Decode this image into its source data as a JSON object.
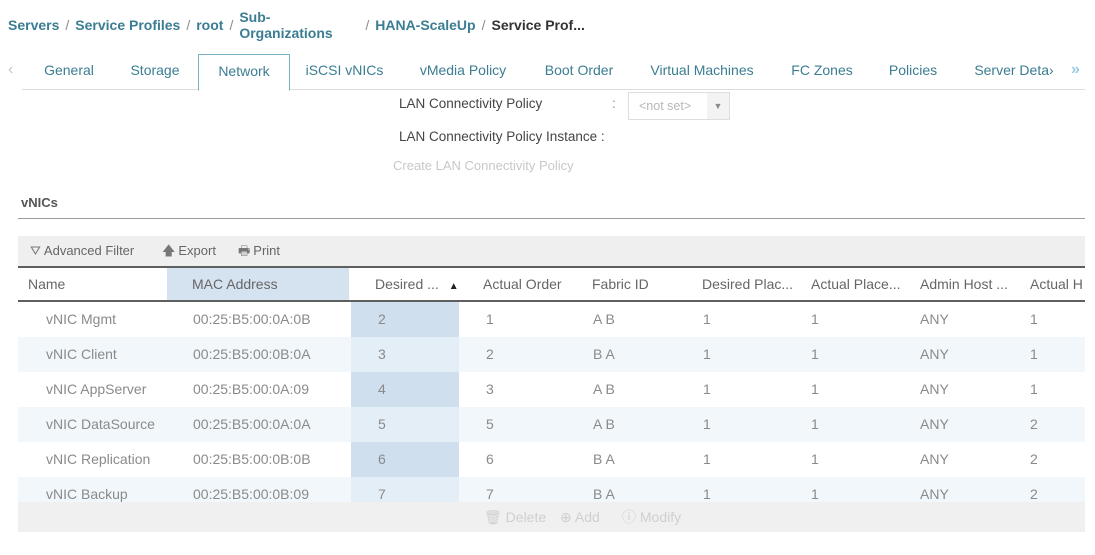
{
  "breadcrumb": {
    "items": [
      "Servers",
      "Service Profiles",
      "root"
    ],
    "sub_org_line1": "Sub-",
    "sub_org_line2": "Organizations",
    "org": "HANA-ScaleUp",
    "current": "Service Prof...",
    "separator": "/"
  },
  "tabs": {
    "prev_icon": "‹",
    "next_icon": "»",
    "items": [
      {
        "label": "General"
      },
      {
        "label": "Storage"
      },
      {
        "label": "Network",
        "active": true
      },
      {
        "label": "iSCSI vNICs"
      },
      {
        "label": "vMedia Policy"
      },
      {
        "label": "Boot Order"
      },
      {
        "label": "Virtual Machines"
      },
      {
        "label": "FC Zones"
      },
      {
        "label": "Policies"
      },
      {
        "label": "Server Deta›"
      }
    ]
  },
  "lan": {
    "policy_label": "LAN Connectivity Policy",
    "colon": ":",
    "policy_value": "<not set>",
    "dropdown_icon": "▼",
    "instance_label": "LAN Connectivity Policy Instance :",
    "create_link": "Create LAN Connectivity Policy"
  },
  "vnics": {
    "title": "vNICs",
    "toolbar": {
      "filter_icon": "⛛",
      "filter_label": "Advanced Filter",
      "export_icon": "🡅",
      "export_label": "Export",
      "print_icon": "🖶",
      "print_label": "Print"
    },
    "columns": [
      "Name",
      "MAC Address",
      "Desired ...",
      "Actual Order",
      "Fabric ID",
      "Desired Plac...",
      "Actual Place...",
      "Admin Host ...",
      "Actual H"
    ],
    "sort_icon": "▲",
    "rows": [
      [
        "vNIC Mgmt",
        "00:25:B5:00:0A:0B",
        "2",
        "1",
        "A B",
        "1",
        "1",
        "ANY",
        "1"
      ],
      [
        "vNIC Client",
        "00:25:B5:00:0B:0A",
        "3",
        "2",
        "B A",
        "1",
        "1",
        "ANY",
        "1"
      ],
      [
        "vNIC AppServer",
        "00:25:B5:00:0A:09",
        "4",
        "3",
        "A B",
        "1",
        "1",
        "ANY",
        "1"
      ],
      [
        "vNIC DataSource",
        "00:25:B5:00:0A:0A",
        "5",
        "5",
        "A B",
        "1",
        "1",
        "ANY",
        "2"
      ],
      [
        "vNIC Replication",
        "00:25:B5:00:0B:0B",
        "6",
        "6",
        "B A",
        "1",
        "1",
        "ANY",
        "2"
      ],
      [
        "vNIC Backup",
        "00:25:B5:00:0B:09",
        "7",
        "7",
        "B A",
        "1",
        "1",
        "ANY",
        "2"
      ]
    ],
    "footer": {
      "delete_icon": "🗑",
      "delete_label": "Delete",
      "add_icon": "⊕",
      "add_label": "Add",
      "modify_icon": "ⓘ",
      "modify_label": "Modify"
    }
  }
}
